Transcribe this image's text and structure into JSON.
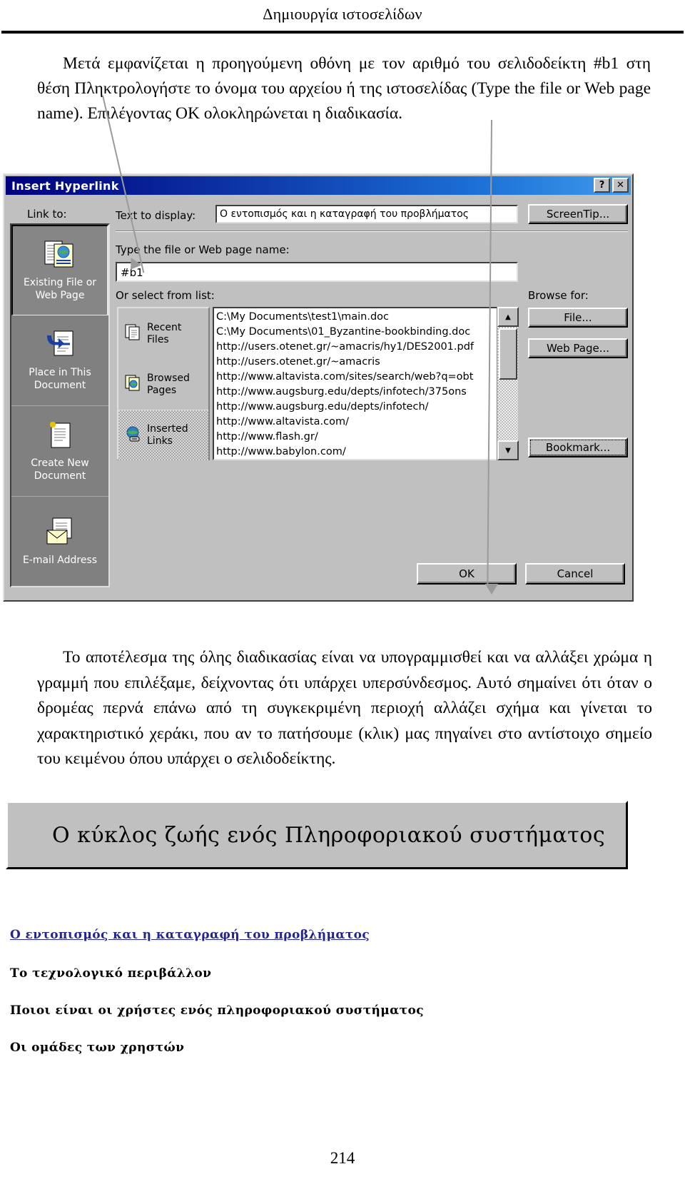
{
  "page": {
    "header_title": "Δημιουργία ιστοσελίδων",
    "page_number": "214",
    "intro_paragraph": "Μετά εμφανίζεται η προηγούμενη οθόνη με τον αριθμό του σελιδοδείκτη #b1 στη θέση Πληκτρολογήστε το όνομα του αρχείου ή της ιστοσελίδας (Type the file or Web page name). Επιλέγοντας ΟΚ ολοκληρώνεται η διαδικασία.",
    "body_paragraph": "Το αποτέλεσμα της όλης διαδικασίας είναι να υπογραμμισθεί και να αλλάξει χρώμα η γραμμή που επιλέξαμε, δείχνοντας ότι υπάρχει υπερσύνδεσμος. Αυτό σημαίνει ότι όταν ο δρομέας περνά επάνω από τη συγκεκριμένη περιοχή αλλάζει σχήμα και γίνεται το χαρακτηριστικό χεράκι, που αν το πατήσουμε (κλικ) μας πηγαίνει στο αντίστοιχο σημείο του κειμένου όπου υπάρχει ο σελιδοδείκτης."
  },
  "dialog": {
    "title": "Insert Hyperlink",
    "titlebar_buttons": [
      {
        "name": "help-button",
        "glyph": "?"
      },
      {
        "name": "close-button",
        "glyph": "✕"
      }
    ],
    "link_to_label": "Link to:",
    "link_to_items": [
      {
        "label_line1": "Existing File or",
        "label_line2": "Web Page",
        "icon": "existing-file-web-page-icon",
        "selected": true
      },
      {
        "label_line1": "Place in This",
        "label_line2": "Document",
        "icon": "place-in-document-icon",
        "selected": false
      },
      {
        "label_line1": "Create New",
        "label_line2": "Document",
        "icon": "create-new-document-icon",
        "selected": false
      },
      {
        "label_line1": "E-mail Address",
        "label_line2": "",
        "icon": "email-address-icon",
        "selected": false
      }
    ],
    "text_to_display_label": "Text to display:",
    "text_to_display_value": "Ο εντοπισμός και η καταγραφή του προβλήματος",
    "screentip_button": "ScreenTip...",
    "type_name_label": "Type the file or Web page name:",
    "type_name_value": "#b1",
    "or_select_label": "Or select from list:",
    "source_items": [
      {
        "label_line1": "Recent",
        "label_line2": "Files",
        "icon": "recent-files-icon",
        "selected": false
      },
      {
        "label_line1": "Browsed",
        "label_line2": "Pages",
        "icon": "browsed-pages-icon",
        "selected": false
      },
      {
        "label_line1": "Inserted",
        "label_line2": "Links",
        "icon": "inserted-links-icon",
        "selected": true
      }
    ],
    "list_items": [
      "C:\\My Documents\\test1\\main.doc",
      "C:\\My Documents\\01_Byzantine-bookbinding.doc",
      "http://users.otenet.gr/~amacris/hy1/DES2001.pdf",
      "http://users.otenet.gr/~amacris",
      "http://www.altavista.com/sites/search/web?q=obt",
      "http://www.augsburg.edu/depts/infotech/375ons",
      "http://www.augsburg.edu/depts/infotech/",
      "http://www.altavista.com/",
      "http://www.flash.gr/",
      "http://www.babylon.com/"
    ],
    "scroll_up_glyph": "▲",
    "scroll_down_glyph": "▼",
    "browse_for_label": "Browse for:",
    "file_button": "File...",
    "web_page_button": "Web Page...",
    "bookmark_button": "Bookmark...",
    "ok_button": "OK",
    "cancel_button": "Cancel"
  },
  "web_preview": {
    "banner_title": "Ο κύκλος ζωής ενός Πληροφοριακού συστήματος",
    "links": [
      {
        "text": "Ο εντοπισμός και η καταγραφή του προβλήματος",
        "style": "hyperlink",
        "color": "#24248f"
      },
      {
        "text": "Το τεχνολογικό περιβάλλον",
        "style": "plain",
        "color": "#000000"
      },
      {
        "text": "Ποιοι είναι οι χρήστες ενός πληροφοριακού συστήματος",
        "style": "plain",
        "color": "#000000"
      },
      {
        "text": "Οι ομάδες των χρηστών",
        "style": "plain",
        "color": "#000000"
      }
    ]
  },
  "colors": {
    "titlebar_start": "#00007e",
    "titlebar_end": "#3f9bea",
    "dialog_face": "#c0c0c0",
    "panel_gray": "#808080",
    "hyperlink_blue": "#24248f",
    "callout_gray": "#9a9a9a"
  }
}
